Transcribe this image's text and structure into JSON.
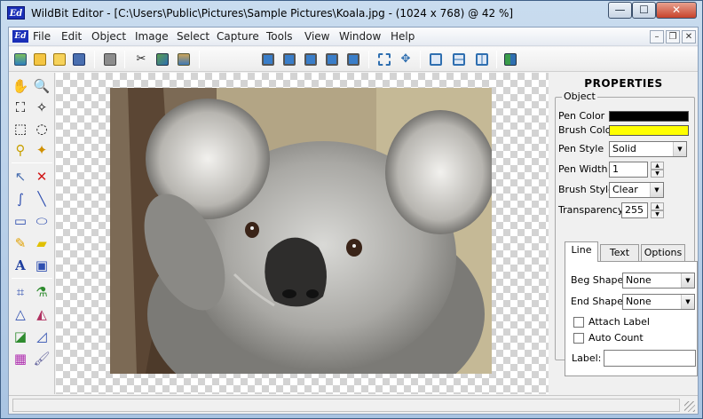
{
  "window": {
    "app_icon_text": "Ed",
    "title": "WildBit Editor - [C:\\Users\\Public\\Pictures\\Sample Pictures\\Koala.jpg - (1024 x 768) @ 42  %]",
    "minimize": "—",
    "maximize": "☐",
    "close": "✕"
  },
  "menubar": {
    "doc_icon_text": "Ed",
    "items": [
      "File",
      "Edit",
      "Object",
      "Image",
      "Select",
      "Capture",
      "Tools",
      "View",
      "Window",
      "Help"
    ],
    "mdi_minimize": "–",
    "mdi_restore": "❐",
    "mdi_close": "✕"
  },
  "toolbar": {
    "buttons": [
      "new-image-icon",
      "open-icon",
      "open-folder-icon",
      "save-icon",
      "print-icon",
      "cut-icon",
      "copy-icon",
      "paste-icon",
      "monitor-1-icon",
      "monitor-2-icon",
      "monitor-3-icon",
      "monitor-4-icon",
      "monitor-5-icon",
      "fit-window-icon",
      "pan-icon",
      "cascade-icon",
      "tile-horizontal-icon",
      "tile-vertical-icon",
      "exit-icon"
    ]
  },
  "tools": {
    "items": [
      "hand-icon",
      "zoom-icon",
      "select-lasso-icon",
      "select-freeform-icon",
      "select-rect-icon",
      "select-ellipse-icon",
      "clone-stamp-icon",
      "magic-wand-icon",
      "pointer-icon",
      "delete-x-icon",
      "freehand-line-icon",
      "line-icon",
      "rectangle-icon",
      "ellipse-icon",
      "pencil-icon",
      "sticky-note-icon",
      "text-icon",
      "text-frame-icon",
      "crop-icon",
      "eyedropper-icon",
      "rotate-icon",
      "flip-icon",
      "adjust-icon",
      "measure-icon",
      "palette-icon",
      "brush-icon"
    ]
  },
  "image": {
    "subject": "koala photograph"
  },
  "properties": {
    "title": "PROPERTIES",
    "group_label": "Object",
    "pen_color_label": "Pen Color",
    "pen_color": "#000000",
    "brush_color_label": "Brush Color",
    "brush_color": "#ffff00",
    "pen_style_label": "Pen Style",
    "pen_style": "Solid",
    "pen_width_label": "Pen Width",
    "pen_width": "1",
    "brush_style_label": "Brush Style",
    "brush_style": "Clear",
    "transparency_label": "Transparency",
    "transparency": "255",
    "tabs": [
      "Line",
      "Text",
      "Options"
    ],
    "beg_shape_label": "Beg Shape",
    "beg_shape": "None",
    "end_shape_label": "End Shape",
    "end_shape": "None",
    "attach_label": "Attach Label",
    "auto_count": "Auto Count",
    "label_label": "Label:",
    "label_value": ""
  },
  "colors": {
    "title_bar": "#b8cfe8",
    "close_button": "#c7432c",
    "brush_yellow": "#ffff00"
  }
}
